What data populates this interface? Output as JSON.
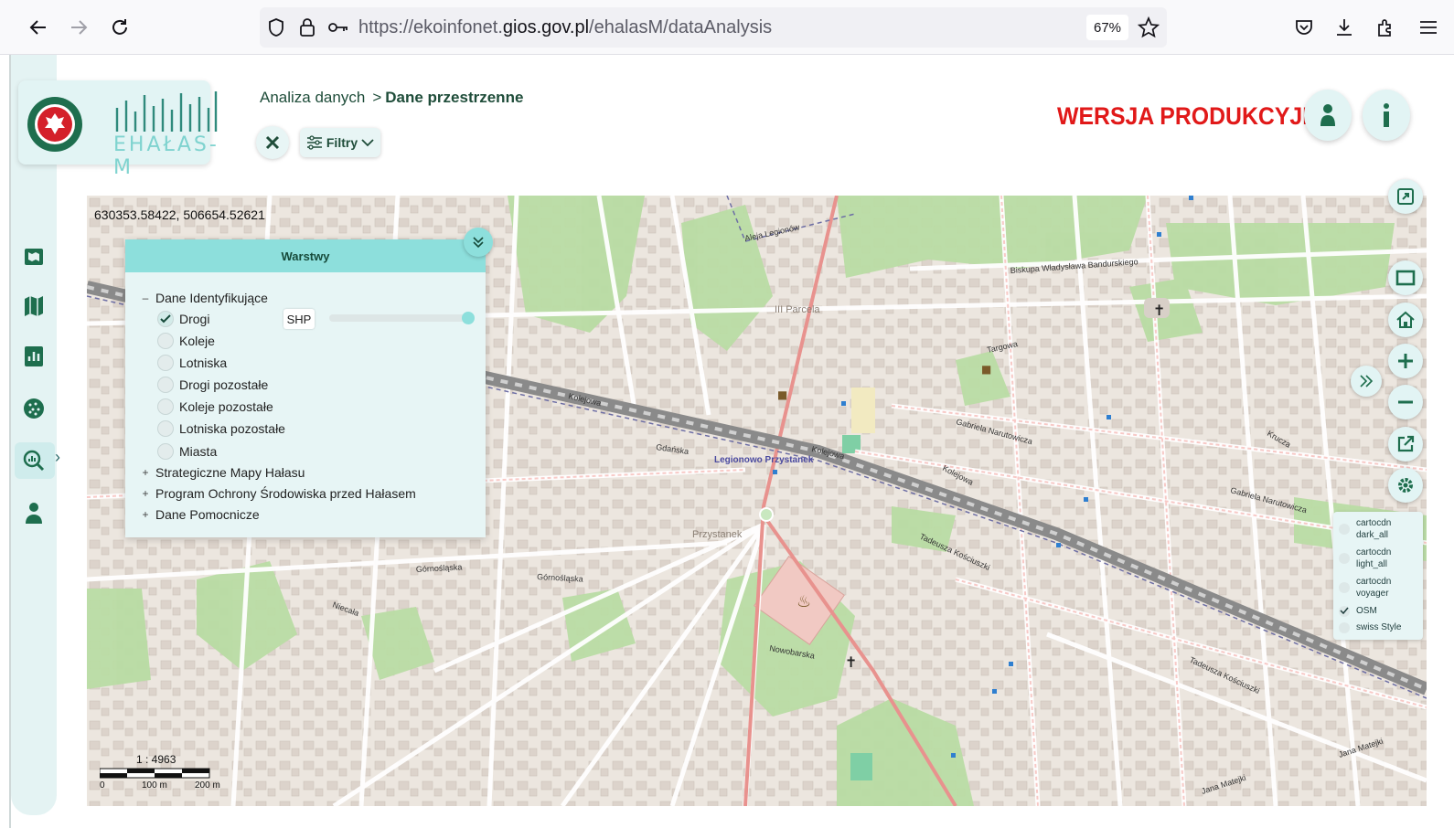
{
  "browser": {
    "url_prefix": "https://ekoinfonet.",
    "url_domain": "gios.gov.pl",
    "url_path": "/ehalasM/dataAnalysis",
    "zoom": "67%"
  },
  "app": {
    "logo_text": "EHAŁAS-M",
    "breadcrumb": {
      "item_1": "Analiza danych",
      "separator": ">",
      "item_2": "Dane przestrzenne"
    },
    "filter_label": "Filtry",
    "environment_label": "WERSJA PRODUKCYJNA"
  },
  "map": {
    "coordinates": "630353.58422, 506654.52621",
    "scale_label": "1 : 4963",
    "scale_ticks": [
      "0",
      "100 m",
      "200 m"
    ]
  },
  "layers_panel": {
    "title": "Warstwy",
    "groups": [
      {
        "label": "Dane Identyfikujące",
        "toggle": "–"
      },
      {
        "label": "Strategiczne Mapy Hałasu",
        "toggle": "+"
      },
      {
        "label": "Program Ochrony Środowiska przed Hałasem",
        "toggle": "+"
      },
      {
        "label": "Dane Pomocnicze",
        "toggle": "+"
      }
    ],
    "layers": [
      {
        "label": "Drogi",
        "checked": true
      },
      {
        "label": "Koleje",
        "checked": false
      },
      {
        "label": "Lotniska",
        "checked": false
      },
      {
        "label": "Drogi pozostałe",
        "checked": false
      },
      {
        "label": "Koleje pozostałe",
        "checked": false
      },
      {
        "label": "Lotniska pozostałe",
        "checked": false
      },
      {
        "label": "Miasta",
        "checked": false
      }
    ],
    "format_badge": "SHP",
    "opacity": 1.0
  },
  "basemaps": [
    {
      "line1": "cartocdn",
      "line2": "dark_all",
      "selected": false
    },
    {
      "line1": "cartocdn",
      "line2": "light_all",
      "selected": false
    },
    {
      "line1": "cartocdn",
      "line2": "voyager",
      "selected": false
    },
    {
      "line1": "OSM",
      "line2": "",
      "selected": true
    },
    {
      "line1": "swiss Style",
      "line2": "",
      "selected": false
    }
  ],
  "map_labels": {
    "street_1": "Aleja Legionów",
    "street_2": "Biskupa Władysława Bandurskiego",
    "street_3": "Kolejowa",
    "street_4": "Gabriela Narutowicza",
    "street_5": "Tadeusza Kościuszki",
    "station": "Legionowo Przystanek",
    "street_6": "Gdańska",
    "street_7": "Nowobarska",
    "street_8": "Górnośląska",
    "street_9": "Targowa",
    "street_10": "Krucza",
    "place_1": "Przystanek",
    "place_2": "III Parcela",
    "street_11": "Jana Matejki",
    "street_12": "Niecała"
  },
  "colors": {
    "accent": "#8ddfdc",
    "production_label": "#e11919",
    "primary_road": "#e8928e",
    "rail": "#8a8a8a"
  }
}
